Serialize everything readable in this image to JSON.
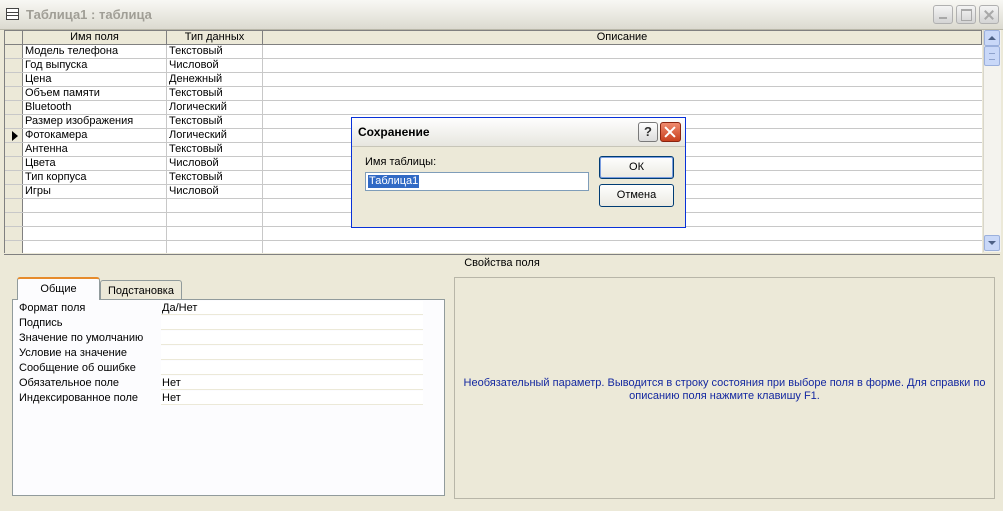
{
  "window": {
    "title": "Таблица1 : таблица"
  },
  "grid": {
    "columns": [
      "Имя поля",
      "Тип данных",
      "Описание"
    ],
    "rows": [
      {
        "name": "Модель телефона",
        "type": "Текстовый",
        "desc": ""
      },
      {
        "name": "Год выпуска",
        "type": "Числовой",
        "desc": ""
      },
      {
        "name": "Цена",
        "type": "Денежный",
        "desc": ""
      },
      {
        "name": "Объем памяти",
        "type": "Текстовый",
        "desc": ""
      },
      {
        "name": "Bluetooth",
        "type": "Логический",
        "desc": ""
      },
      {
        "name": "Размер изображения",
        "type": "Текстовый",
        "desc": ""
      },
      {
        "name": "Фотокамера",
        "type": "Логический",
        "desc": "",
        "current": true
      },
      {
        "name": "Антенна",
        "type": "Текстовый",
        "desc": ""
      },
      {
        "name": "Цвета",
        "type": "Числовой",
        "desc": ""
      },
      {
        "name": "Тип корпуса",
        "type": "Текстовый",
        "desc": ""
      },
      {
        "name": "Игры",
        "type": "Числовой",
        "desc": ""
      },
      {
        "name": "",
        "type": "",
        "desc": ""
      },
      {
        "name": "",
        "type": "",
        "desc": ""
      },
      {
        "name": "",
        "type": "",
        "desc": ""
      },
      {
        "name": "",
        "type": "",
        "desc": ""
      }
    ]
  },
  "field_properties": {
    "header": "Свойства поля",
    "tabs": [
      {
        "label": "Общие",
        "active": true
      },
      {
        "label": "Подстановка",
        "active": false
      }
    ],
    "properties": [
      {
        "label": "Формат поля",
        "value": "Да/Нет"
      },
      {
        "label": "Подпись",
        "value": ""
      },
      {
        "label": "Значение по умолчанию",
        "value": ""
      },
      {
        "label": "Условие на значение",
        "value": ""
      },
      {
        "label": "Сообщение об ошибке",
        "value": ""
      },
      {
        "label": "Обязательное поле",
        "value": "Нет"
      },
      {
        "label": "Индексированное поле",
        "value": "Нет"
      }
    ],
    "hint": "Необязательный параметр.  Выводится в строку состояния при выборе поля в форме.  Для справки по описанию поля нажмите клавишу F1."
  },
  "dialog": {
    "title": "Сохранение",
    "help_label": "?",
    "field_label": "Имя таблицы:",
    "field_value": "Таблица1",
    "ok_label": "ОК",
    "cancel_label": "Отмена"
  },
  "colors": {
    "window_bg": "#ece9d8",
    "hint_text": "#1428a0",
    "dialog_border": "#0831d9",
    "selection": "#316ac5"
  }
}
